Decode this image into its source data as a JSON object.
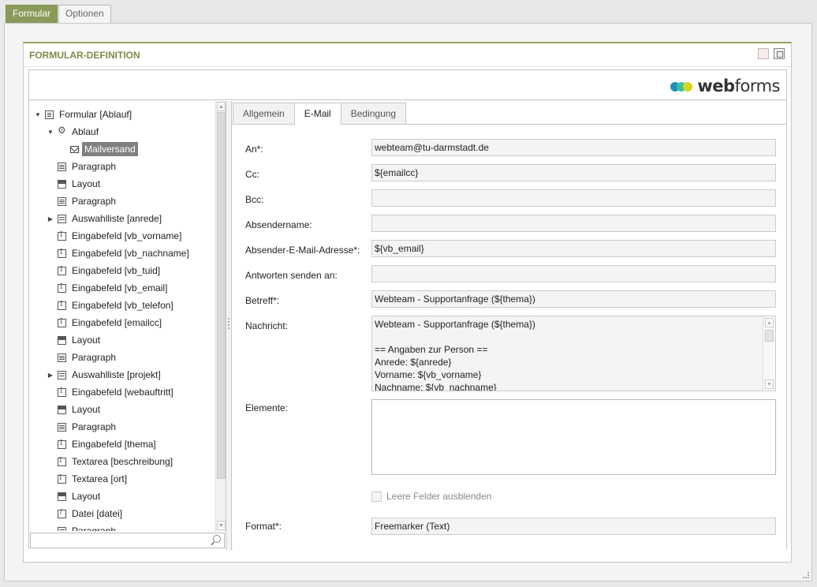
{
  "outer_tabs": [
    {
      "label": "Formular",
      "active": true
    },
    {
      "label": "Optionen",
      "active": false
    }
  ],
  "panel": {
    "title": "FORMULAR-DEFINITION",
    "icons": [
      "document-icon",
      "window-icon"
    ]
  },
  "logo": {
    "text_bold": "web",
    "text_regular": "forms"
  },
  "tree": {
    "items": [
      {
        "label": "Formular [Ablauf]",
        "icon": "form",
        "level": 0,
        "expander": "▼"
      },
      {
        "label": "Ablauf",
        "icon": "gear",
        "level": 1,
        "expander": "▼"
      },
      {
        "label": "Mailversand",
        "icon": "mail",
        "level": 2,
        "expander": "",
        "selected": true
      },
      {
        "label": "Paragraph",
        "icon": "para",
        "level": 1,
        "expander": ""
      },
      {
        "label": "Layout",
        "icon": "layout",
        "level": 1,
        "expander": ""
      },
      {
        "label": "Paragraph",
        "icon": "para",
        "level": 1,
        "expander": ""
      },
      {
        "label": "Auswahlliste [anrede]",
        "icon": "select",
        "level": 1,
        "expander": "▶"
      },
      {
        "label": "Eingabefeld [vb_vorname]",
        "icon": "input",
        "level": 1,
        "expander": ""
      },
      {
        "label": "Eingabefeld [vb_nachname]",
        "icon": "input",
        "level": 1,
        "expander": ""
      },
      {
        "label": "Eingabefeld [vb_tuid]",
        "icon": "input",
        "level": 1,
        "expander": ""
      },
      {
        "label": "Eingabefeld [vb_email]",
        "icon": "input",
        "level": 1,
        "expander": ""
      },
      {
        "label": "Eingabefeld [vb_telefon]",
        "icon": "input",
        "level": 1,
        "expander": ""
      },
      {
        "label": "Eingabefeld [emailcc]",
        "icon": "input",
        "level": 1,
        "expander": ""
      },
      {
        "label": "Layout",
        "icon": "layout",
        "level": 1,
        "expander": ""
      },
      {
        "label": "Paragraph",
        "icon": "para",
        "level": 1,
        "expander": ""
      },
      {
        "label": "Auswahlliste [projekt]",
        "icon": "select",
        "level": 1,
        "expander": "▶"
      },
      {
        "label": "Eingabefeld [webauftritt]",
        "icon": "input",
        "level": 1,
        "expander": ""
      },
      {
        "label": "Layout",
        "icon": "layout",
        "level": 1,
        "expander": ""
      },
      {
        "label": "Paragraph",
        "icon": "para",
        "level": 1,
        "expander": ""
      },
      {
        "label": "Eingabefeld [thema]",
        "icon": "input",
        "level": 1,
        "expander": ""
      },
      {
        "label": "Textarea [beschreibung]",
        "icon": "textarea",
        "level": 1,
        "expander": ""
      },
      {
        "label": "Textarea [ort]",
        "icon": "textarea",
        "level": 1,
        "expander": ""
      },
      {
        "label": "Layout",
        "icon": "layout",
        "level": 1,
        "expander": ""
      },
      {
        "label": "Datei [datei]",
        "icon": "file",
        "level": 1,
        "expander": ""
      },
      {
        "label": "Paragraph",
        "icon": "para",
        "level": 1,
        "expander": ""
      }
    ],
    "search_value": ""
  },
  "detail": {
    "tabs": [
      {
        "label": "Allgemein",
        "active": false
      },
      {
        "label": "E-Mail",
        "active": true
      },
      {
        "label": "Bedingung",
        "active": false
      }
    ],
    "fields": {
      "an": {
        "label": "An*:",
        "value": "webteam@tu-darmstadt.de"
      },
      "cc": {
        "label": "Cc:",
        "value": "${emailcc}"
      },
      "bcc": {
        "label": "Bcc:",
        "value": ""
      },
      "absendername": {
        "label": "Absendername:",
        "value": ""
      },
      "absender_email": {
        "label": "Absender-E-Mail-Adresse*:",
        "value": "${vb_email}"
      },
      "antworten": {
        "label": "Antworten senden an:",
        "value": ""
      },
      "betreff": {
        "label": "Betreff*:",
        "value": "Webteam - Supportanfrage (${thema})"
      },
      "nachricht": {
        "label": "Nachricht:",
        "lines": [
          "Webteam - Supportanfrage (${thema})",
          "",
          "== Angaben zur Person ==",
          "Anrede: ${anrede}",
          "Vorname: ${vb_vorname}",
          "Nachname: ${vb_nachname}"
        ]
      },
      "elemente": {
        "label": "Elemente:",
        "value": ""
      },
      "leere_felder": {
        "label": "Leere Felder ausblenden",
        "checked": false
      },
      "format": {
        "label": "Format*:",
        "value": "Freemarker (Text)"
      }
    }
  }
}
